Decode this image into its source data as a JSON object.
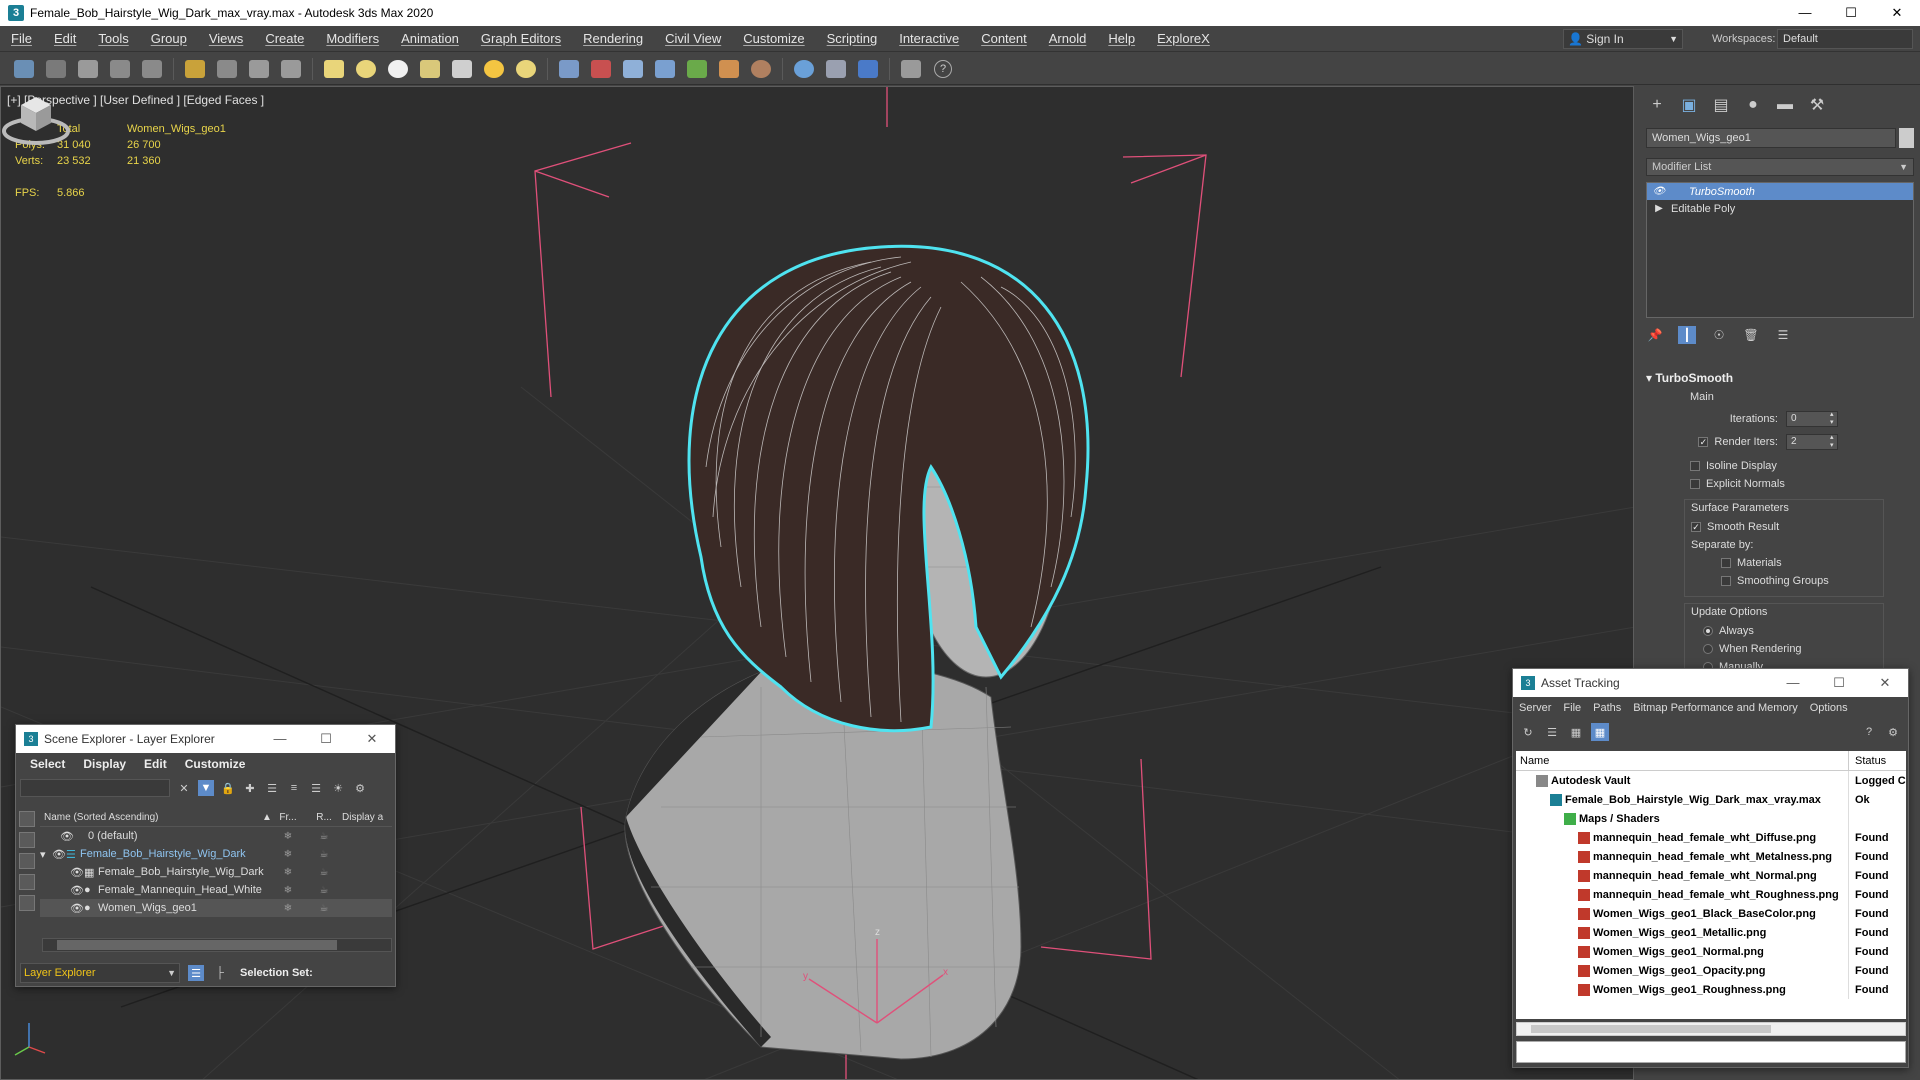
{
  "window": {
    "title": "Female_Bob_Hairstyle_Wig_Dark_max_vray.max - Autodesk 3ds Max 2020",
    "app_icon": "3"
  },
  "menu": [
    "File",
    "Edit",
    "Tools",
    "Group",
    "Views",
    "Create",
    "Modifiers",
    "Animation",
    "Graph Editors",
    "Rendering",
    "Civil View",
    "Customize",
    "Scripting",
    "Interactive",
    "Content",
    "Arnold",
    "Help",
    "ExploreX"
  ],
  "account": {
    "sign_in": "Sign In",
    "workspaces_label": "Workspaces:",
    "workspace": "Default"
  },
  "viewport": {
    "label": "[+] [Perspective ] [User Defined ] [Edged Faces ]",
    "stats": {
      "total_label": "Total",
      "object_label": "Women_Wigs_geo1",
      "polys_label": "Polys:",
      "polys_total": "31 040",
      "polys_obj": "26 700",
      "verts_label": "Verts:",
      "verts_total": "23 532",
      "verts_obj": "21 360",
      "fps_label": "FPS:",
      "fps": "5.866"
    },
    "gizmo_labels": {
      "z": "z",
      "y": "y",
      "x": "x"
    }
  },
  "command_panel": {
    "object_name": "Women_Wigs_geo1",
    "modifier_list": "Modifier List",
    "stack": [
      {
        "label": "TurboSmooth",
        "selected": true
      },
      {
        "label": "Editable Poly",
        "selected": false
      }
    ],
    "rollout_title": "TurboSmooth",
    "main_group": "Main",
    "iterations_label": "Iterations:",
    "iterations": "0",
    "render_iters_label": "Render Iters:",
    "render_iters": "2",
    "isoline": "Isoline Display",
    "explicit_normals": "Explicit Normals",
    "surface_group": "Surface Parameters",
    "smooth_result": "Smooth Result",
    "separate_by": "Separate by:",
    "materials": "Materials",
    "smoothing_groups": "Smoothing Groups",
    "update_group": "Update Options",
    "always": "Always",
    "when_rendering": "When Rendering",
    "manually": "Manually"
  },
  "scene_explorer": {
    "title": "Scene Explorer - Layer Explorer",
    "menu": [
      "Select",
      "Display",
      "Edit",
      "Customize"
    ],
    "col_name": "Name (Sorted Ascending)",
    "col_fr": "Fr...",
    "col_r": "R...",
    "col_display": "Display a",
    "rows": [
      {
        "label": "0 (default)",
        "indent": 1,
        "hl": false
      },
      {
        "label": "Female_Bob_Hairstyle_Wig_Dark",
        "indent": 0,
        "hl": false
      },
      {
        "label": "Female_Bob_Hairstyle_Wig_Dark",
        "indent": 2,
        "hl": false
      },
      {
        "label": "Female_Mannequin_Head_White",
        "indent": 2,
        "hl": false
      },
      {
        "label": "Women_Wigs_geo1",
        "indent": 2,
        "hl": true
      }
    ],
    "layer_explorer": "Layer Explorer",
    "selection_set": "Selection Set:"
  },
  "asset_tracking": {
    "title": "Asset Tracking",
    "menu": [
      "Server",
      "File",
      "Paths",
      "Bitmap Performance and Memory",
      "Options"
    ],
    "col_name": "Name",
    "col_status": "Status",
    "rows": [
      {
        "name": "Autodesk Vault",
        "status": "Logged C",
        "indent": 1,
        "icon": "vault"
      },
      {
        "name": "Female_Bob_Hairstyle_Wig_Dark_max_vray.max",
        "status": "Ok",
        "indent": 2,
        "icon": "max"
      },
      {
        "name": "Maps / Shaders",
        "status": "",
        "indent": 3,
        "icon": "maps"
      },
      {
        "name": "mannequin_head_female_wht_Diffuse.png",
        "status": "Found",
        "indent": 4,
        "icon": "png"
      },
      {
        "name": "mannequin_head_female_wht_Metalness.png",
        "status": "Found",
        "indent": 4,
        "icon": "png"
      },
      {
        "name": "mannequin_head_female_wht_Normal.png",
        "status": "Found",
        "indent": 4,
        "icon": "png"
      },
      {
        "name": "mannequin_head_female_wht_Roughness.png",
        "status": "Found",
        "indent": 4,
        "icon": "png"
      },
      {
        "name": "Women_Wigs_geo1_Black_BaseColor.png",
        "status": "Found",
        "indent": 4,
        "icon": "png"
      },
      {
        "name": "Women_Wigs_geo1_Metallic.png",
        "status": "Found",
        "indent": 4,
        "icon": "png"
      },
      {
        "name": "Women_Wigs_geo1_Normal.png",
        "status": "Found",
        "indent": 4,
        "icon": "png"
      },
      {
        "name": "Women_Wigs_geo1_Opacity.png",
        "status": "Found",
        "indent": 4,
        "icon": "png"
      },
      {
        "name": "Women_Wigs_geo1_Roughness.png",
        "status": "Found",
        "indent": 4,
        "icon": "png"
      }
    ]
  },
  "colors": {
    "accent": "#5d8bc9",
    "selection_outline": "#4fe3f0",
    "stats_text": "#e8d44a",
    "layer_text": "#f0c419",
    "gizmo": "#e0507a"
  }
}
